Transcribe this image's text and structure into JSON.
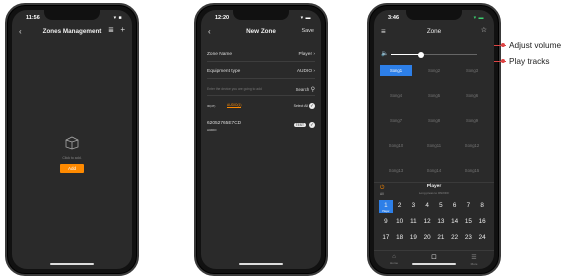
{
  "phone1": {
    "time": "11:56",
    "status": "▾ ■",
    "back": "‹",
    "title": "Zones Management",
    "menu_icon": "≣",
    "plus": "+",
    "empty_text": "Click to add.",
    "add_label": "Add"
  },
  "phone2": {
    "time": "12:20",
    "status": "▾ ▬",
    "back": "‹",
    "title": "New Zone",
    "save_label": "Save",
    "zone_name_label": "Zone Name",
    "zone_name_value": "Player",
    "equipment_label": "Equipment type",
    "equipment_value": "AUDIO",
    "search_hint": "Enter the device you are going to add",
    "search_label": "Search",
    "filter_all": "ID(47)",
    "filter_audio": "AUDIO(1)",
    "select_all": "Select All",
    "device_id": "62052765E7CD",
    "device_sub": "AUDIO",
    "test_label": "TEST"
  },
  "phone3": {
    "time": "3:46",
    "status": "▾ ▬",
    "title": "Zone",
    "menu": "≡",
    "star": "☆",
    "songs": [
      "Song1",
      "Song2",
      "Song3",
      "Song4",
      "Song5",
      "Song6",
      "Song7",
      "Song8",
      "Song9",
      "Song10",
      "Song11",
      "Song12",
      "Song13",
      "Song14",
      "Song15"
    ],
    "active_song": 0,
    "volume": 0.35,
    "player_title": "Player",
    "player_sub": "Long press to ON/OFF",
    "all_label": "All",
    "power_icon": "⏻",
    "nums": [
      "1",
      "2",
      "3",
      "4",
      "5",
      "6",
      "7",
      "8",
      "9",
      "10",
      "11",
      "12",
      "13",
      "14",
      "15",
      "16",
      "17",
      "18",
      "19",
      "20",
      "21",
      "22",
      "23",
      "24"
    ],
    "active_num": 0,
    "active_num_sub": "Player",
    "tabs": [
      {
        "icon": "⌂",
        "label": "Home"
      },
      {
        "icon": "☐",
        "label": "Zone"
      },
      {
        "icon": "☰",
        "label": "More"
      }
    ],
    "active_tab": 1
  },
  "annotations": {
    "adjust_volume": "Adjust volume",
    "play_tracks": "Play tracks"
  },
  "colors": {
    "accent_orange": "#ff8a00",
    "accent_blue": "#2d7fe8",
    "annotation_red": "#dd4444"
  }
}
